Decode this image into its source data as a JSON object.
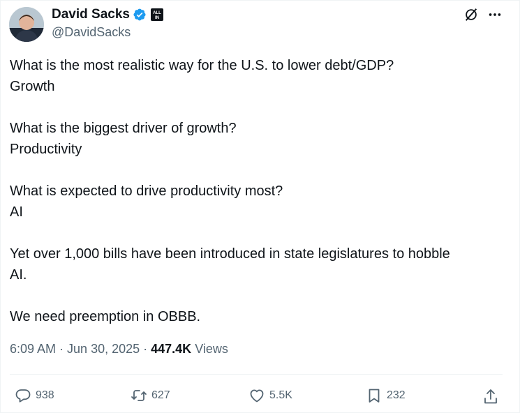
{
  "author": {
    "display_name": "David Sacks",
    "handle": "@DavidSacks",
    "affiliate_badge_text": "ALL IN",
    "verified_color": "#1d9bf0"
  },
  "tweet": {
    "lines": [
      "What is the most realistic way for the U.S. to lower debt/GDP?",
      "Growth",
      "",
      "What is the biggest driver of growth?",
      "Productivity",
      "",
      "What is expected to drive productivity most?",
      "AI",
      "",
      "Yet over 1,000 bills have been introduced in state legislatures to hobble",
      "AI.",
      "",
      "We need preemption in OBBB."
    ]
  },
  "meta": {
    "time": "6:09 AM",
    "sep1": "·",
    "date": "Jun 30, 2025",
    "sep2": "·",
    "views_count": "447.4K",
    "views_label": "Views"
  },
  "actions": {
    "replies": "938",
    "reposts": "627",
    "likes": "5.5K",
    "bookmarks": "232"
  },
  "icons": [
    "grok-icon",
    "more-icon",
    "reply-icon",
    "repost-icon",
    "like-icon",
    "bookmark-icon",
    "share-icon",
    "verified-icon"
  ],
  "colors": {
    "text": "#0f1419",
    "secondary": "#536471",
    "accent": "#1d9bf0"
  }
}
